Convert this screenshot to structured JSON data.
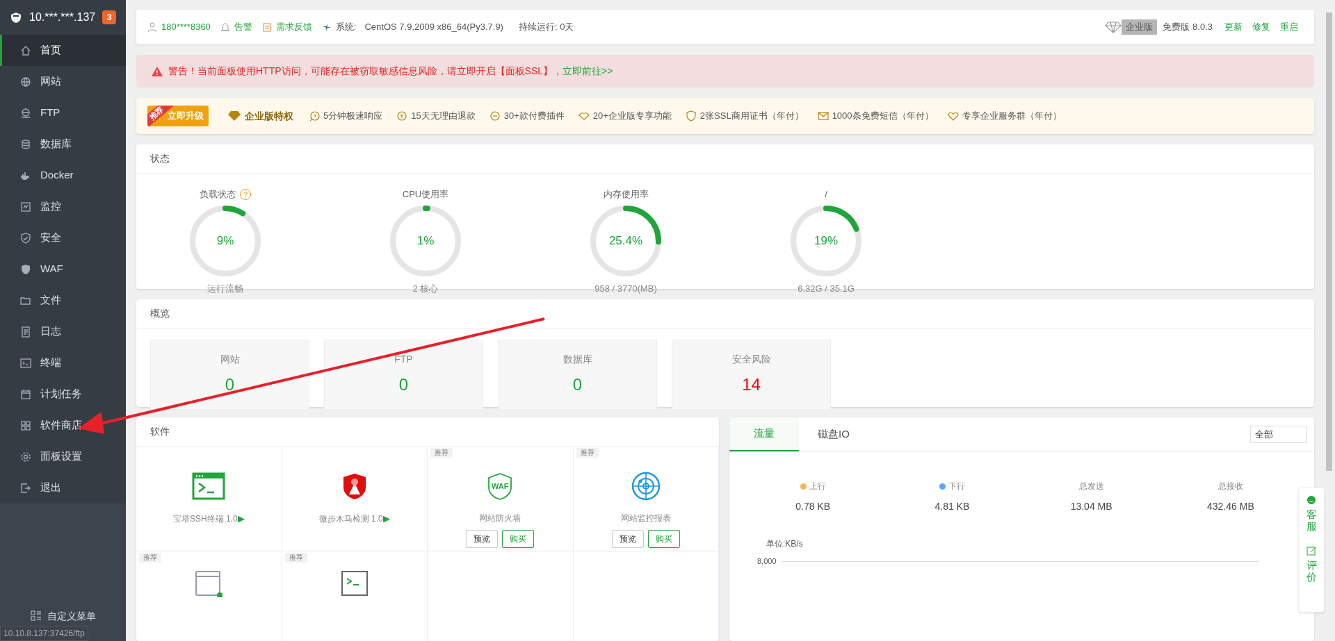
{
  "sidebar": {
    "host": "10.***.***.137",
    "badge": "3",
    "items": [
      {
        "label": "首页",
        "selected": true
      },
      {
        "label": "网站",
        "selected": false
      },
      {
        "label": "FTP",
        "selected": false
      },
      {
        "label": "数据库",
        "selected": false
      },
      {
        "label": "Docker",
        "selected": false
      },
      {
        "label": "监控",
        "selected": false
      },
      {
        "label": "安全",
        "selected": false
      },
      {
        "label": "WAF",
        "selected": false
      },
      {
        "label": "文件",
        "selected": false
      },
      {
        "label": "日志",
        "selected": false
      },
      {
        "label": "终端",
        "selected": false
      },
      {
        "label": "计划任务",
        "selected": false
      },
      {
        "label": "软件商店",
        "selected": false
      },
      {
        "label": "面板设置",
        "selected": false
      },
      {
        "label": "退出",
        "selected": false
      }
    ],
    "custom_menu": "自定义菜单"
  },
  "topbar": {
    "user": "180****8360",
    "alert": "告警",
    "feedback": "需求反馈",
    "system_label": "系统:",
    "system": "CentOS 7.9.2009 x86_64(Py3.7.9)",
    "uptime": "持续运行: 0天",
    "edition_badge": "企业版",
    "version": "免费版 8.0.3",
    "actions": [
      "更新",
      "修复",
      "重启"
    ]
  },
  "warning": {
    "text": "警告！当前面板使用HTTP访问，可能存在被窃取敏感信息风险，请立即开启【面板SSL】，",
    "link": "立即前往>>"
  },
  "promo": {
    "ribbon": "推荐",
    "button": "立即升级",
    "title": "企业版特权",
    "features": [
      "5分钟极速响应",
      "15天无理由退款",
      "30+款付费插件",
      "20+企业版专享功能",
      "2张SSL商用证书（年付）",
      "1000条免费短信（年付）",
      "专享企业服务群（年付）"
    ]
  },
  "status": {
    "title": "状态",
    "gauges": [
      {
        "label": "负载状态",
        "help": "?",
        "value": "9%",
        "level": 0.09,
        "detail": "运行流畅"
      },
      {
        "label": "CPU使用率",
        "value": "1%",
        "level": 0.01,
        "detail": "2 核心"
      },
      {
        "label": "内存使用率",
        "value": "25.4%",
        "level": 0.254,
        "detail": "958 / 3770(MB)"
      },
      {
        "label": "/",
        "value": "19%",
        "level": 0.19,
        "detail": "6.32G / 35.1G"
      }
    ]
  },
  "overview": {
    "title": "概览",
    "cards": [
      {
        "label": "网站",
        "value": "0",
        "warning": false
      },
      {
        "label": "FTP",
        "value": "0",
        "warning": false
      },
      {
        "label": "数据库",
        "value": "0",
        "warning": false
      },
      {
        "label": "安全风险",
        "value": "14",
        "warning": true
      }
    ]
  },
  "software": {
    "title": "软件",
    "items": [
      {
        "kind": "terminal",
        "name": "宝塔SSH终端 1.0",
        "play": "▶"
      },
      {
        "kind": "shield",
        "name": "微步木马检测 1.0",
        "play": "▶"
      },
      {
        "kind": "waf",
        "icon_text": "WAF",
        "name": "网站防火墙",
        "tag": "推荐",
        "buttons": [
          "预览",
          "购买"
        ]
      },
      {
        "kind": "radar",
        "name": "网站监控报表",
        "tag": "推荐",
        "buttons": [
          "预览",
          "购买"
        ]
      },
      {
        "kind": "window",
        "tag": "推荐"
      },
      {
        "kind": "console",
        "tag": "推荐"
      }
    ]
  },
  "traffic": {
    "tabs": [
      {
        "label": "流量",
        "selected": true
      },
      {
        "label": "磁盘IO",
        "selected": false
      }
    ],
    "filter": "全部",
    "stats": [
      {
        "label": "上行",
        "value": "0.78 KB",
        "color": "#f7b851"
      },
      {
        "label": "下行",
        "value": "4.81 KB",
        "color": "#52a9ff"
      },
      {
        "label": "总发送",
        "value": "13.04 MB"
      },
      {
        "label": "总接收",
        "value": "432.46 MB"
      }
    ],
    "unit": "单位:KB/s",
    "tick": "8,000"
  },
  "float_widget": [
    "客服",
    "评价"
  ],
  "status_url": "10.10.8.137:37426/ftp"
}
